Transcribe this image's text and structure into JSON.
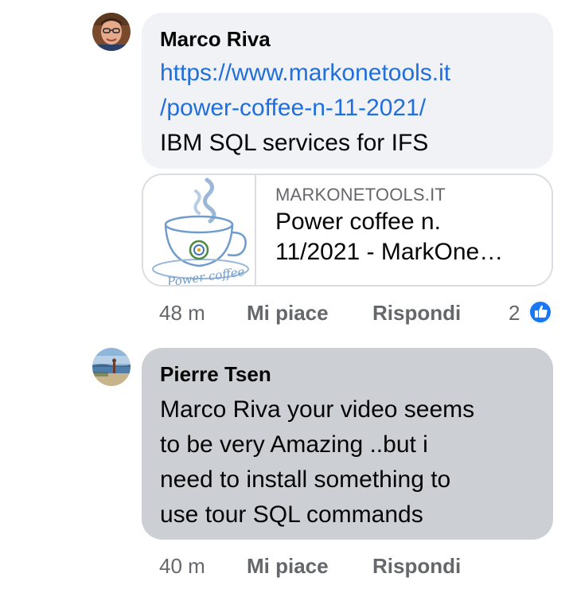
{
  "comments": [
    {
      "author": "Marco Riva",
      "link_line1": "https://www.markonetools.it",
      "link_line2": "/power-coffee-n-11-2021/",
      "text": "IBM SQL services for IFS",
      "preview": {
        "domain": "MARKONETOOLS.IT",
        "title_line1": "Power coffee n.",
        "title_line2": "11/2021 - MarkOne…",
        "thumb_caption": "Power coffee"
      },
      "time": "48 m",
      "like_label": "Mi piace",
      "reply_label": "Rispondi",
      "reaction_count": "2",
      "reaction_icon": "like-icon"
    },
    {
      "author": "Pierre Tsen",
      "lines": [
        "Marco Riva your video seems",
        "to be very Amazing ..but i",
        "need to install something to",
        "use tour SQL commands"
      ],
      "time": "40 m",
      "like_label": "Mi piace",
      "reply_label": "Rispondi"
    }
  ],
  "colors": {
    "bubble_light": "#f0f2f5",
    "bubble_selected": "#ccd0d5",
    "link": "#216fdb",
    "meta": "#65676b",
    "like_blue": "#1877f2"
  }
}
